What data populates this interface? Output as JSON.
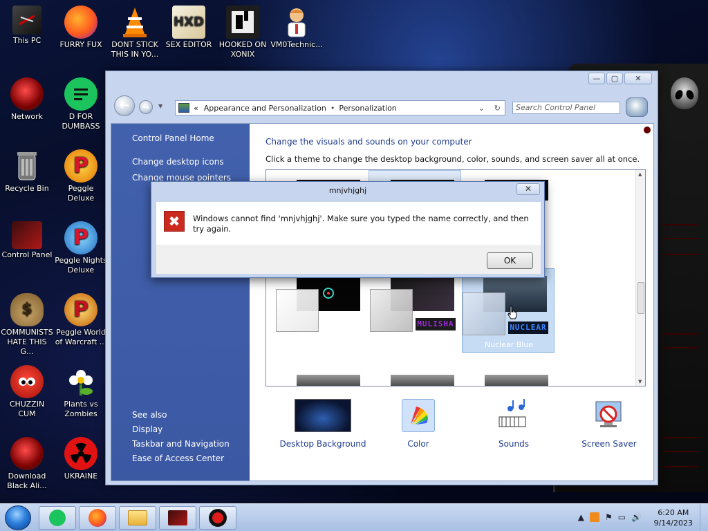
{
  "desktop": {
    "icons": [
      {
        "label": "This PC"
      },
      {
        "label": "FURRY FUX"
      },
      {
        "label": "DONT STICK\nTHIS IN YO..."
      },
      {
        "label": "SEX EDITOR"
      },
      {
        "label": "HOOKED ON\nXONIX"
      },
      {
        "label": "VM0Technic..."
      },
      {
        "label": "Network"
      },
      {
        "label": "D FOR\nDUMBASS"
      },
      {
        "label": "Recycle Bin"
      },
      {
        "label": "Peggle Deluxe"
      },
      {
        "label": "Control Panel"
      },
      {
        "label": "Peggle Nights\nDeluxe"
      },
      {
        "label": "COMMUNISTS\nHATE THIS G..."
      },
      {
        "label": "Peggle World\nof Warcraft ..."
      },
      {
        "label": "CHUZZIN\nCUM"
      },
      {
        "label": "Plants vs\nZombies"
      },
      {
        "label": "Download\nBlack Ali..."
      },
      {
        "label": "UKRAINE"
      }
    ],
    "hex_editor_glyph": "HXD"
  },
  "control_panel": {
    "address": {
      "recent_marker": "«",
      "crumb1": "Appearance and Personalization",
      "separator": "•",
      "crumb2": "Personalization",
      "dropdown_glyph": "⌄",
      "refresh_glyph": "↻"
    },
    "search_placeholder": "Search Control Panel",
    "window_buttons": {
      "minimize": "—",
      "maximize": "▢",
      "close": "✕"
    },
    "sidebar": {
      "home": "Control Panel Home",
      "links": [
        "Change desktop icons",
        "Change mouse pointers"
      ],
      "see_also_header": "See also",
      "see_also": [
        "Display",
        "Taskbar and Navigation",
        "Ease of Access Center"
      ]
    },
    "main": {
      "title": "Change the visuals and sounds on your computer",
      "subtitle": "Click a theme to change the desktop background, color, sounds, and screen saver all at once.",
      "themes": [
        {
          "badge": ""
        },
        {
          "badge": "MULISHA",
          "badge_color": "#9a2ad8"
        },
        {
          "badge": "NUCLEAR",
          "badge_color": "#2a5fd8",
          "name": "Nuclear Blue",
          "selected": true
        }
      ],
      "tools": [
        "Desktop Background",
        "Color",
        "Sounds",
        "Screen Saver"
      ]
    }
  },
  "dialog": {
    "title": "mnjvhjghj",
    "message": "Windows cannot find 'mnjvhjghj'. Make sure you typed the name correctly, and then try again.",
    "ok": "OK",
    "close_glyph": "✕",
    "icon_glyph": "✖"
  },
  "taskbar": {
    "time": "6:20 AM",
    "date": "9/14/2023",
    "tray_glyphs": [
      "▲",
      "⚑",
      "▭",
      "🔊"
    ]
  },
  "colors": {
    "accent_link": "#1e3b8c",
    "sidebar_blue": "#3f5ea9",
    "error_red": "#cc2a1f",
    "alien_readout_red": "#cc0000"
  }
}
